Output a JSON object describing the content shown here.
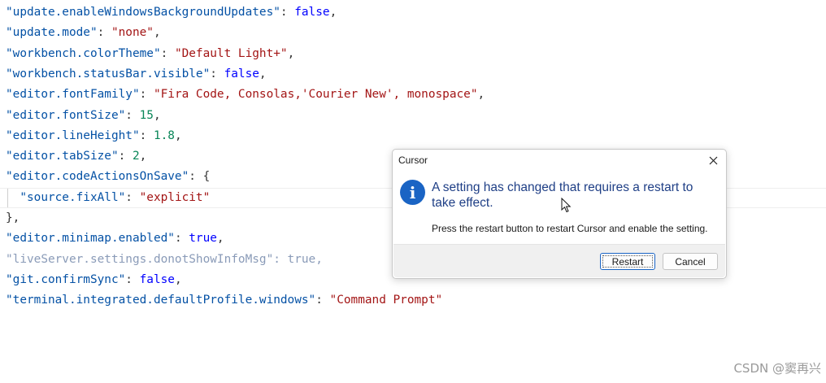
{
  "colors": {
    "key": "#0451a5",
    "string": "#a31515",
    "number": "#098658",
    "keyword": "#0000ff",
    "punctuation": "#333333",
    "faded": "#8a9bb8",
    "icon_blue": "#1a64c4",
    "instruction_text": "#1f3f86"
  },
  "editor": {
    "lines": [
      {
        "tokens": [
          {
            "t": "\"update.enableWindowsBackgroundUpdates\"",
            "c": "key"
          },
          {
            "t": ": ",
            "c": "punctuation"
          },
          {
            "t": "false",
            "c": "keyword"
          },
          {
            "t": ",",
            "c": "punctuation"
          }
        ]
      },
      {
        "tokens": [
          {
            "t": "\"update.mode\"",
            "c": "key"
          },
          {
            "t": ": ",
            "c": "punctuation"
          },
          {
            "t": "\"none\"",
            "c": "string"
          },
          {
            "t": ",",
            "c": "punctuation"
          }
        ]
      },
      {
        "tokens": [
          {
            "t": "\"workbench.colorTheme\"",
            "c": "key"
          },
          {
            "t": ": ",
            "c": "punctuation"
          },
          {
            "t": "\"Default Light+\"",
            "c": "string"
          },
          {
            "t": ",",
            "c": "punctuation"
          }
        ]
      },
      {
        "tokens": [
          {
            "t": "\"workbench.statusBar.visible\"",
            "c": "key"
          },
          {
            "t": ": ",
            "c": "punctuation"
          },
          {
            "t": "false",
            "c": "keyword"
          },
          {
            "t": ",",
            "c": "punctuation"
          }
        ]
      },
      {
        "tokens": [
          {
            "t": "\"editor.fontFamily\"",
            "c": "key"
          },
          {
            "t": ": ",
            "c": "punctuation"
          },
          {
            "t": "\"Fira Code, Consolas,'Courier New', monospace\"",
            "c": "string"
          },
          {
            "t": ",",
            "c": "punctuation"
          }
        ]
      },
      {
        "tokens": [
          {
            "t": "\"editor.fontSize\"",
            "c": "key"
          },
          {
            "t": ": ",
            "c": "punctuation"
          },
          {
            "t": "15",
            "c": "number"
          },
          {
            "t": ",",
            "c": "punctuation"
          }
        ]
      },
      {
        "tokens": [
          {
            "t": "\"editor.lineHeight\"",
            "c": "key"
          },
          {
            "t": ": ",
            "c": "punctuation"
          },
          {
            "t": "1.8",
            "c": "number"
          },
          {
            "t": ",",
            "c": "punctuation"
          }
        ]
      },
      {
        "tokens": [
          {
            "t": "\"editor.tabSize\"",
            "c": "key"
          },
          {
            "t": ": ",
            "c": "punctuation"
          },
          {
            "t": "2",
            "c": "number"
          },
          {
            "t": ",",
            "c": "punctuation"
          }
        ]
      },
      {
        "tokens": [
          {
            "t": "\"editor.codeActionsOnSave\"",
            "c": "key"
          },
          {
            "t": ": {",
            "c": "punctuation"
          }
        ]
      },
      {
        "current": true,
        "indent": true,
        "tokens": [
          {
            "t": "  ",
            "c": "punctuation"
          },
          {
            "t": "\"source.fixAll\"",
            "c": "key"
          },
          {
            "t": ": ",
            "c": "punctuation"
          },
          {
            "t": "\"explicit\"",
            "c": "string"
          }
        ]
      },
      {
        "tokens": [
          {
            "t": "},",
            "c": "punctuation"
          }
        ]
      },
      {
        "tokens": [
          {
            "t": "\"editor.minimap.enabled\"",
            "c": "key"
          },
          {
            "t": ": ",
            "c": "punctuation"
          },
          {
            "t": "true",
            "c": "keyword"
          },
          {
            "t": ",",
            "c": "punctuation"
          }
        ]
      },
      {
        "tokens": [
          {
            "t": "\"liveServer.settings.donotShowInfoMsg\": true,",
            "c": "faded"
          }
        ]
      },
      {
        "tokens": [
          {
            "t": "\"git.confirmSync\"",
            "c": "key"
          },
          {
            "t": ": ",
            "c": "punctuation"
          },
          {
            "t": "false",
            "c": "keyword"
          },
          {
            "t": ",",
            "c": "punctuation"
          }
        ]
      },
      {
        "tokens": [
          {
            "t": "\"terminal.integrated.defaultProfile.windows\"",
            "c": "key"
          },
          {
            "t": ": ",
            "c": "punctuation"
          },
          {
            "t": "\"Command Prompt\"",
            "c": "string"
          }
        ]
      }
    ]
  },
  "dialog": {
    "title": "Cursor",
    "icon": "info-icon",
    "icon_glyph": "i",
    "main_instruction": "A setting has changed that requires a restart to take effect.",
    "content": "Press the restart button to restart Cursor and enable the setting.",
    "restart_label": "Restart",
    "cancel_label": "Cancel"
  },
  "watermark": "CSDN @窦再兴"
}
